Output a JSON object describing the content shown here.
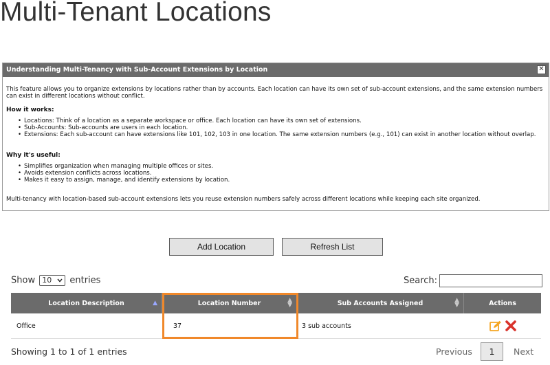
{
  "page": {
    "title": "Multi-Tenant Locations"
  },
  "info_dialog": {
    "title": "Understanding Multi-Tenancy with Sub-Account Extensions by Location",
    "close_symbol": "✕",
    "intro": "This feature allows you to organize extensions by locations rather than by accounts. Each location can have its own set of sub-account extensions, and the same extension numbers can exist in different locations without conflict.",
    "how_heading": "How it works:",
    "how_items": [
      "Locations: Think of a location as a separate workspace or office. Each location can have its own set of extensions.",
      "Sub-Accounts: Sub-accounts are users in each location.",
      "Extensions: Each sub-account can have extensions like 101, 102, 103 in one location. The same extension numbers (e.g., 101) can exist in another location without overlap."
    ],
    "why_heading": "Why it's useful:",
    "why_items": [
      "Simplifies organization when managing multiple offices or sites.",
      "Avoids extension conflicts across locations.",
      "Makes it easy to assign, manage, and identify extensions by location."
    ],
    "summary": "Multi-tenancy with location-based sub-account extensions lets you reuse extension numbers safely across different locations while keeping each site organized."
  },
  "actions": {
    "add_label": "Add Location",
    "refresh_label": "Refresh List"
  },
  "table_controls": {
    "show_label": "Show",
    "entries_label": "entries",
    "page_length": "10",
    "search_label": "Search:",
    "search_value": ""
  },
  "table": {
    "columns": [
      "Location Description",
      "Location Number",
      "Sub Accounts Assigned",
      "Actions"
    ],
    "rows": [
      {
        "description": "Office",
        "number": "37",
        "sub_accounts": "3 sub accounts",
        "actions": [
          "edit-icon",
          "delete-icon"
        ]
      }
    ]
  },
  "footer": {
    "info": "Showing 1 to 1 of 1 entries",
    "previous": "Previous",
    "current_page": "1",
    "next": "Next"
  },
  "colors": {
    "header_bg": "#6b6b6b",
    "highlight": "#f0882a",
    "edit_icon": "#f5a623",
    "delete_icon": "#d9322b"
  }
}
